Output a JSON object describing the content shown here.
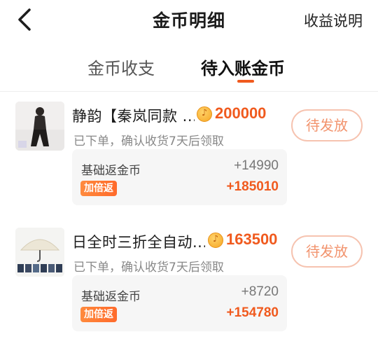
{
  "header": {
    "title": "金币明细",
    "help_label": "收益说明",
    "back_icon": "chevron-left-icon"
  },
  "tabs": [
    {
      "label": "金币收支",
      "active": false
    },
    {
      "label": "待入账金币",
      "active": true
    }
  ],
  "accent_color": "#f05a1e",
  "items": [
    {
      "name": "静韵【秦岚同款 ...",
      "amount": "200000",
      "status": "待发放",
      "subtitle": "已下单，确认收货7天后领取",
      "base_label": "基础返金币",
      "base_value": "+14990",
      "bonus_badge": "加倍返",
      "bonus_value": "+185010"
    },
    {
      "name": "日全时三折全自动...",
      "amount": "163500",
      "status": "待发放",
      "subtitle": "已下单，确认收货7天后领取",
      "base_label": "基础返金币",
      "base_value": "+8720",
      "bonus_badge": "加倍返",
      "bonus_value": "+154780"
    }
  ]
}
